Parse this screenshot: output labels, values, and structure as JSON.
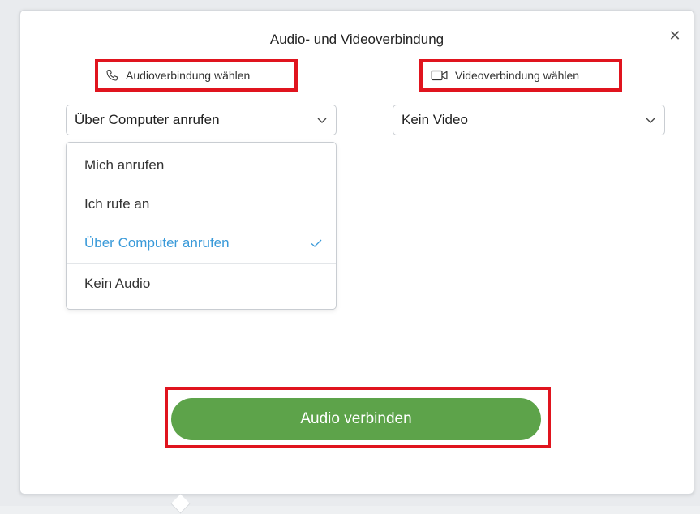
{
  "dialog": {
    "title": "Audio- und Videoverbindung",
    "close_icon": "close-icon"
  },
  "audio": {
    "label": "Audioverbindung wählen",
    "icon": "phone-icon",
    "selected_value": "Über Computer anrufen",
    "options": [
      {
        "label": "Mich anrufen",
        "selected": false
      },
      {
        "label": "Ich rufe an",
        "selected": false
      },
      {
        "label": "Über Computer anrufen",
        "selected": true
      },
      {
        "label": "Kein Audio",
        "selected": false
      }
    ]
  },
  "video": {
    "label": "Videoverbindung wählen",
    "icon": "video-camera-icon",
    "selected_value": "Kein Video"
  },
  "action": {
    "connect_label": "Audio verbinden"
  },
  "colors": {
    "highlight": "#e0141e",
    "primary": "#5da34a",
    "selected_option": "#3a9ad9"
  }
}
